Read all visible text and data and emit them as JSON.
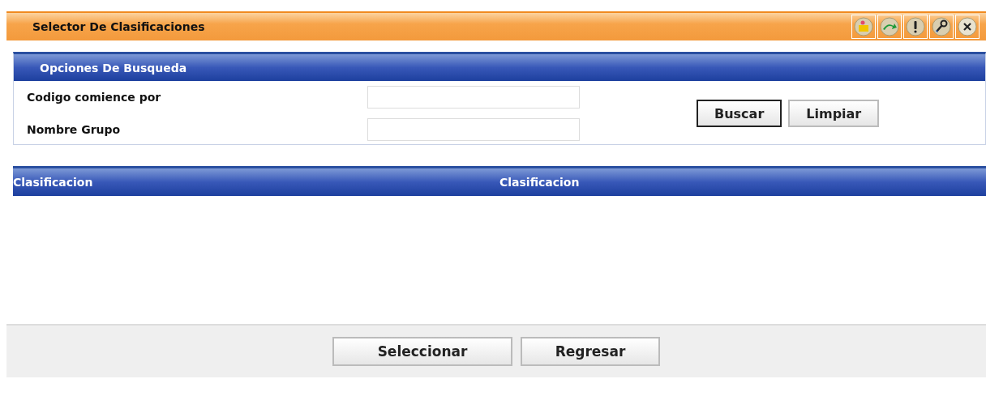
{
  "window": {
    "title": "Selector De Clasificaciones"
  },
  "search_panel": {
    "title": "Opciones De Busqueda",
    "fields": [
      {
        "label": "Codigo comience por"
      },
      {
        "label": "Nombre Grupo"
      }
    ],
    "buttons": [
      {
        "label": "Buscar",
        "default": true
      },
      {
        "label": "Limpiar",
        "default": false
      }
    ]
  },
  "table": {
    "columns": [
      "Clasificacion",
      "Clasificacion"
    ]
  },
  "footer_buttons": [
    {
      "label": "Seleccionar"
    },
    {
      "label": "Regresar"
    }
  ]
}
